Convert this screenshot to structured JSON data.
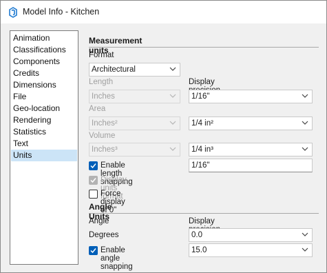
{
  "window": {
    "title": "Model Info - Kitchen"
  },
  "sidebar": {
    "items": [
      {
        "label": "Animation"
      },
      {
        "label": "Classifications"
      },
      {
        "label": "Components"
      },
      {
        "label": "Credits"
      },
      {
        "label": "Dimensions"
      },
      {
        "label": "File"
      },
      {
        "label": "Geo-location"
      },
      {
        "label": "Rendering"
      },
      {
        "label": "Statistics"
      },
      {
        "label": "Text"
      },
      {
        "label": "Units",
        "selected": true
      }
    ]
  },
  "measurement": {
    "title": "Measurement units",
    "format_label": "Format",
    "format_value": "Architectural",
    "length_label": "Length",
    "length_value": "Inches",
    "display_precision_label": "Display precision",
    "length_precision": "1/16\"",
    "area_label": "Area",
    "area_value": "Inches²",
    "area_precision": "1/4 in²",
    "volume_label": "Volume",
    "volume_value": "Inches³",
    "volume_precision": "1/4 in³",
    "length_snapping_label": "Enable length snapping",
    "length_snapping_checked": true,
    "length_snapping_value": "1/16\"",
    "display_units_label": "Display units format",
    "display_units_checked": true,
    "force_zero_label": "Force display of 0\"",
    "force_zero_checked": false
  },
  "angle": {
    "title": "Angle Units",
    "angle_label": "Angle",
    "display_precision_label": "Display precision",
    "angle_value": "Degrees",
    "angle_precision": "0.0",
    "angle_snapping_label": "Enable angle snapping",
    "angle_snapping_checked": true,
    "angle_snapping_value": "15.0"
  },
  "colors": {
    "accent": "#005fb8",
    "selection": "#cce4f7",
    "app_icon": "#1f7ad1"
  },
  "icons": {
    "app": "sketchup-icon",
    "dropdown": "chevron-down-icon",
    "check": "checkmark-icon"
  }
}
